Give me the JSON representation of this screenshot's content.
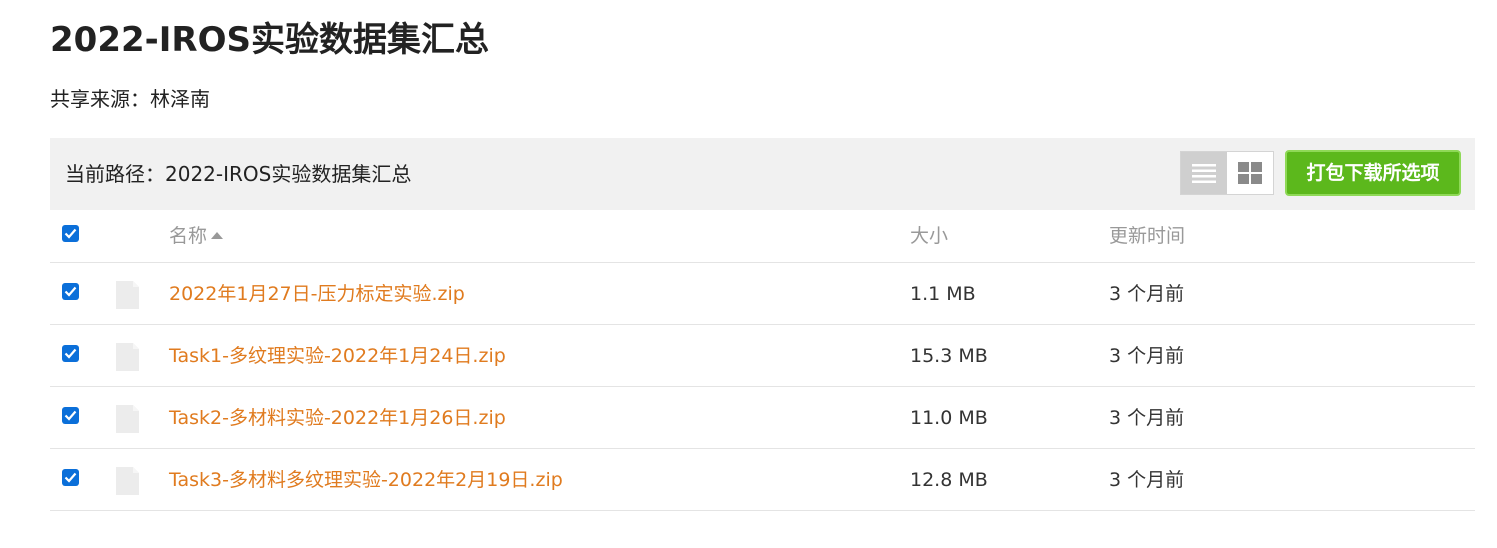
{
  "page": {
    "title": "2022-IROS实验数据集汇总",
    "source": "共享来源：林泽南"
  },
  "pathbar": {
    "path": "当前路径：2022-IROS实验数据集汇总",
    "view_modes": [
      "list-icon",
      "grid-icon"
    ],
    "active_view": "list",
    "download_label": "打包下载所选项"
  },
  "table": {
    "headers": {
      "name": "名称",
      "size": "大小",
      "time": "更新时间"
    },
    "sort": {
      "column": "name",
      "direction": "ascending"
    },
    "select_all": true,
    "rows": [
      {
        "name": "2022年1月27日-压力标定实验.zip",
        "size": "1.1 MB",
        "time": "3 个月前",
        "selected": true
      },
      {
        "name": "Task1-多纹理实验-2022年1月24日.zip",
        "size": "15.3 MB",
        "time": "3 个月前",
        "selected": true
      },
      {
        "name": "Task2-多材料实验-2022年1月26日.zip",
        "size": "11.0 MB",
        "time": "3 个月前",
        "selected": true
      },
      {
        "name": "Task3-多材料多纹理实验-2022年2月19日.zip",
        "size": "12.8 MB",
        "time": "3 个月前",
        "selected": true
      }
    ]
  },
  "colors": {
    "link": "#e07b1f",
    "download_button": "#5cb81c",
    "checkbox": "#0b6fd9",
    "pathbar_bg": "#f1f1f1"
  }
}
